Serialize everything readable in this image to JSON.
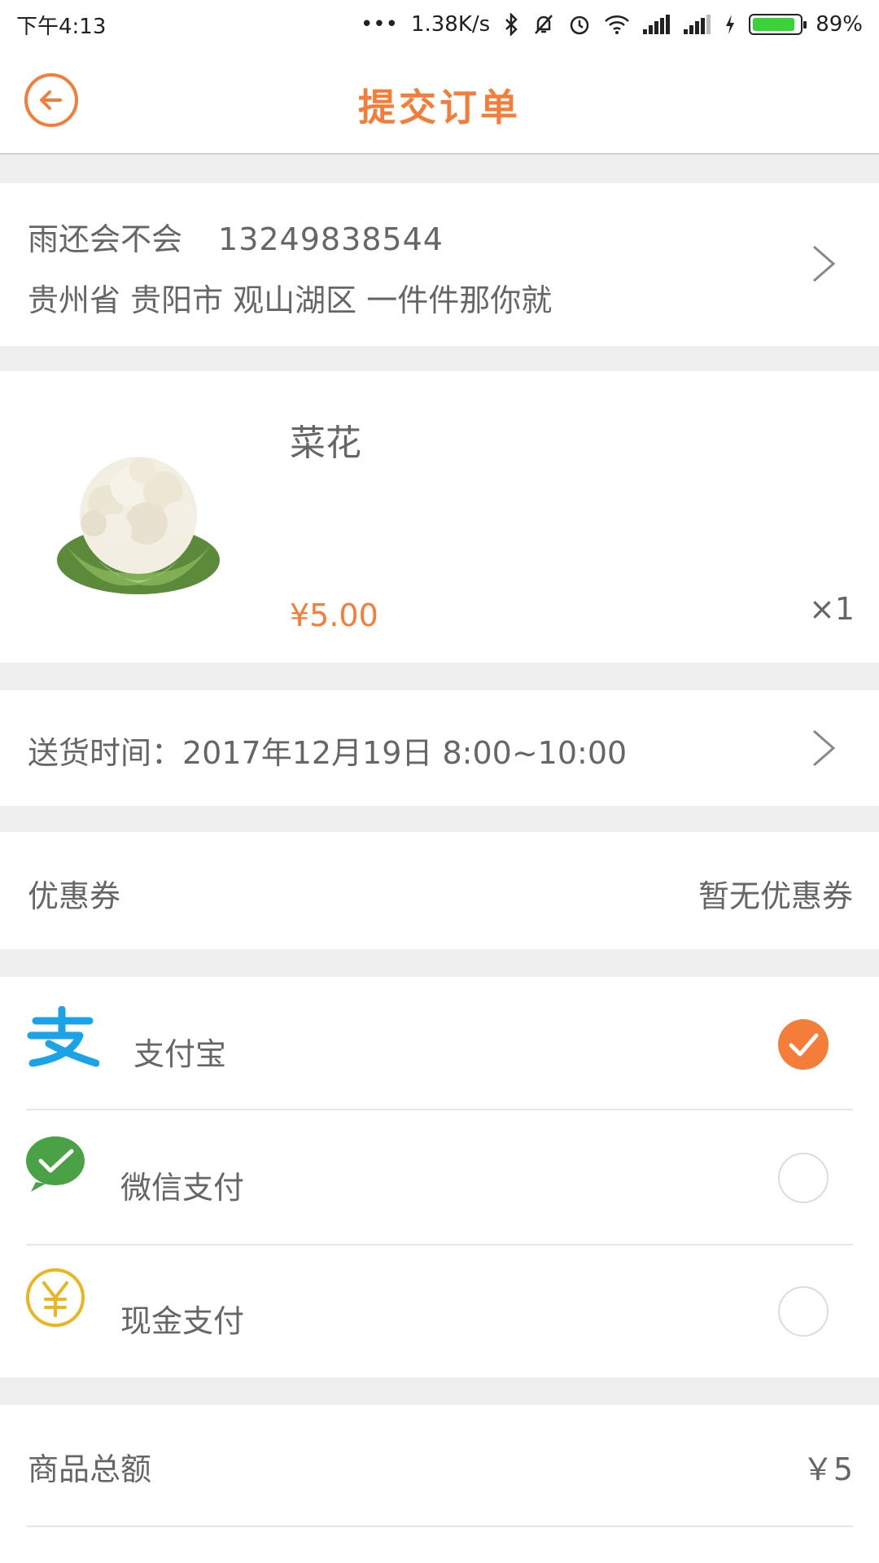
{
  "status_bar": {
    "time": "下午4:13",
    "dots": "•••",
    "net_speed": "1.38K/s",
    "battery": "89%",
    "battery_level": 0.89,
    "icons": [
      "bluetooth-icon",
      "mute-bell-icon",
      "alarm-icon",
      "wifi-icon",
      "signal-icon",
      "signal-icon",
      "charging-icon",
      "battery-icon"
    ]
  },
  "header": {
    "title": "提交订单",
    "back_icon": "back-arrow-icon",
    "accent": "#f47d3a"
  },
  "address": {
    "name": "雨还会不会",
    "phone": "13249838544",
    "detail": "贵州省 贵阳市 观山湖区 一件件那你就"
  },
  "product": {
    "name": "菜花",
    "price": "¥5.00",
    "quantity": "×1",
    "image": "cauliflower-image"
  },
  "delivery": {
    "text": "送货时间：2017年12月19日 8:00~10:00"
  },
  "coupon": {
    "label": "优惠券",
    "value": "暂无优惠券"
  },
  "payment": {
    "methods": [
      {
        "label": "支付宝",
        "icon": "alipay-icon",
        "selected": true,
        "color": "#1aa3e8"
      },
      {
        "label": "微信支付",
        "icon": "wechat-pay-icon",
        "selected": false,
        "color": "#4aa146"
      },
      {
        "label": "现金支付",
        "icon": "cash-yuan-icon",
        "selected": false,
        "color": "#e9b523"
      }
    ]
  },
  "summary": {
    "total_label": "商品总额",
    "total_value": "￥5"
  }
}
